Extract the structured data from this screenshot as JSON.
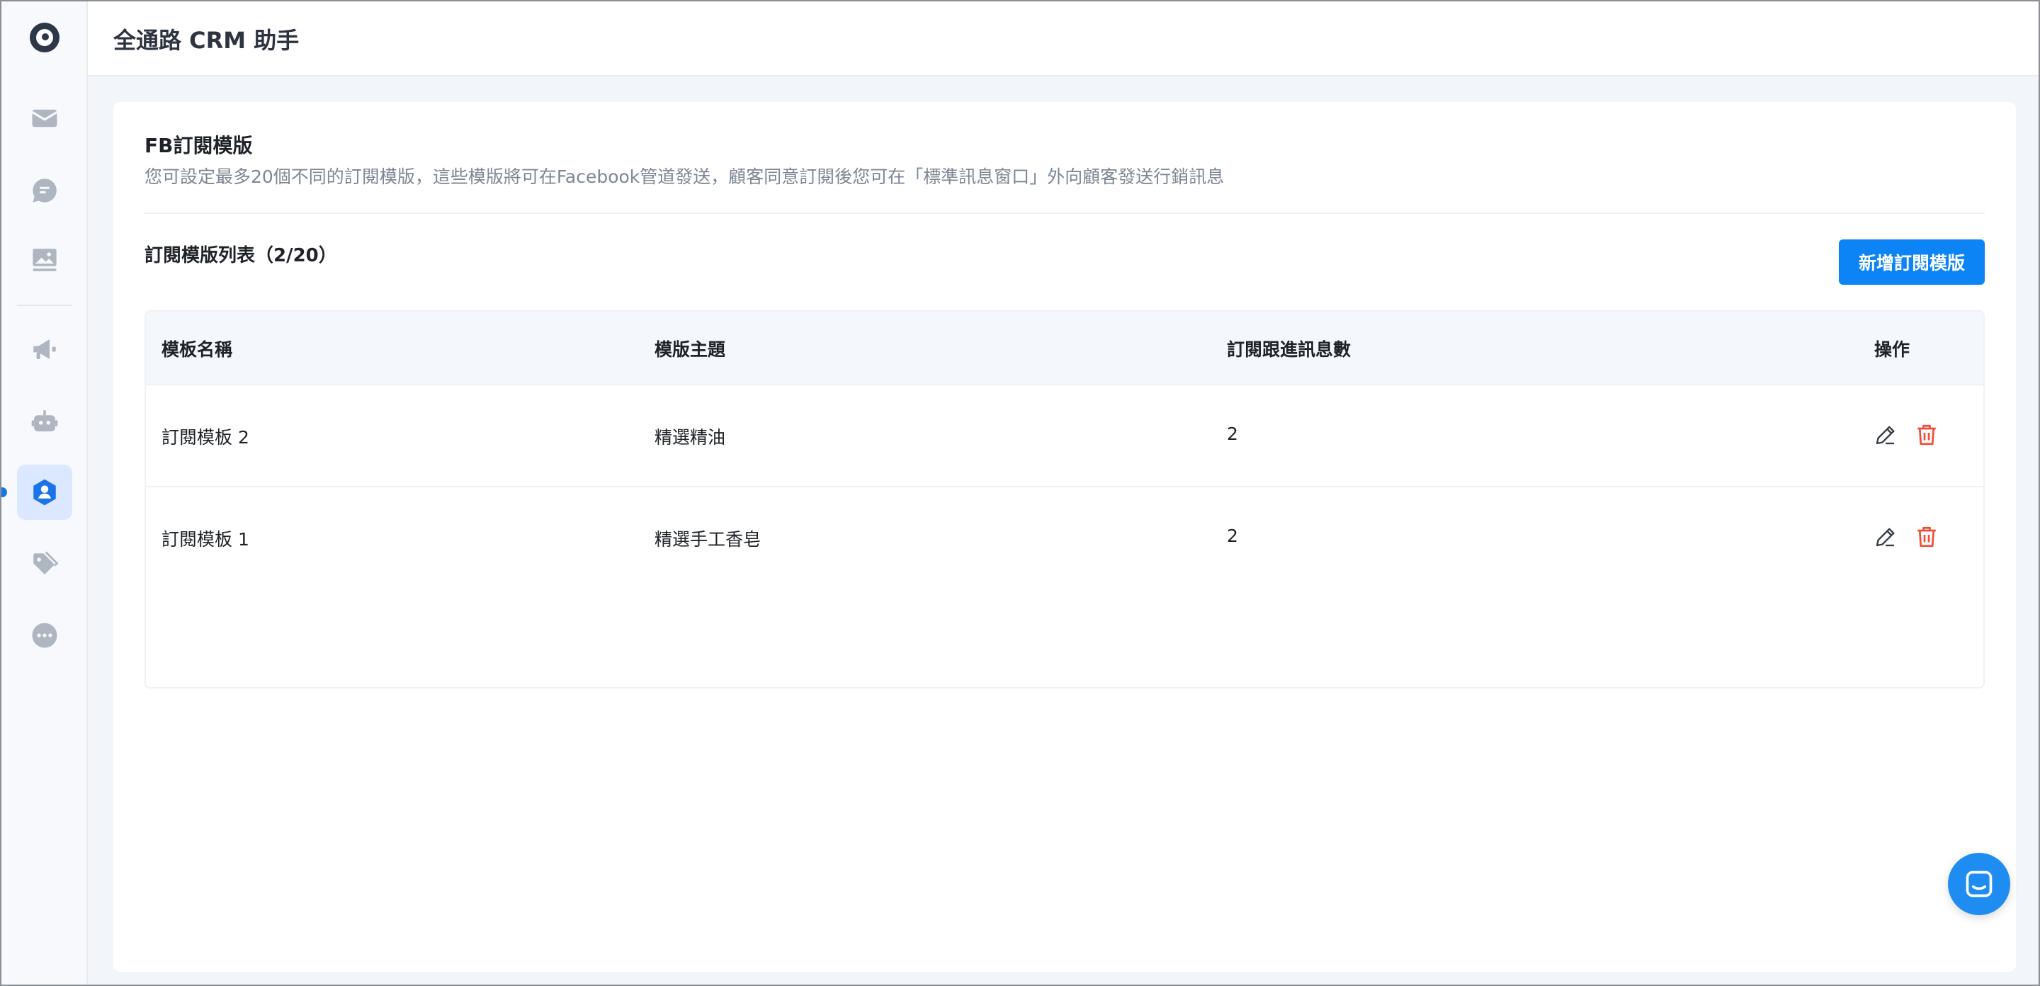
{
  "app": {
    "title": "全通路 CRM 助手"
  },
  "sidebar": {
    "items": [
      {
        "icon": "inbox-icon"
      },
      {
        "icon": "chat-icon"
      },
      {
        "icon": "image-icon"
      },
      {
        "icon": "megaphone-icon"
      },
      {
        "icon": "bot-icon"
      },
      {
        "icon": "contacts-icon",
        "active": true
      },
      {
        "icon": "tag-icon"
      },
      {
        "icon": "more-icon"
      }
    ],
    "accent": "#1a73e8"
  },
  "page": {
    "title": "FB訂閱模版",
    "description": "您可設定最多20個不同的訂閱模版，這些模版將可在Facebook管道發送，顧客同意訂閱後您可在「標準訊息窗口」外向顧客發送行銷訊息",
    "list_title": "訂閱模版列表（2/20）",
    "add_button": "新增訂閱模版"
  },
  "table": {
    "headers": [
      "模板名稱",
      "模版主題",
      "訂閱跟進訊息數",
      "操作"
    ],
    "rows": [
      {
        "name": "訂閱模板 2",
        "topic": "精選精油",
        "count": "2"
      },
      {
        "name": "訂閱模板 1",
        "topic": "精選手工香皂",
        "count": "2"
      }
    ]
  },
  "colors": {
    "primary": "#0d84f5",
    "danger": "#f04d3a",
    "chat_fab": "#1e8cf0"
  }
}
